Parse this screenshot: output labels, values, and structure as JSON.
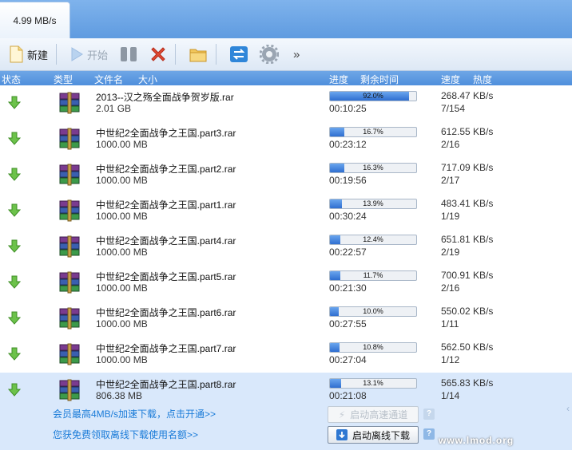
{
  "header": {
    "speed": "4.99 MB/s"
  },
  "toolbar": {
    "new_label": "新建",
    "start_label": "开始",
    "more_label": "»"
  },
  "columns": {
    "status": "状态",
    "type": "类型",
    "filename": "文件名",
    "size": "大小",
    "progress": "进度",
    "remaining": "剩余时间",
    "speed": "速度",
    "heat": "热度"
  },
  "downloads": [
    {
      "name": "2013--汉之殇全面战争贺岁版.rar",
      "size": "2.01 GB",
      "progress_pct": 92.0,
      "progress_label": "92.0%",
      "remaining": "00:10:25",
      "rate": "268.47 KB/s",
      "heat": "7/154"
    },
    {
      "name": "中世纪2全面战争之王国.part3.rar",
      "size": "1000.00 MB",
      "progress_pct": 16.7,
      "progress_label": "16.7%",
      "remaining": "00:23:12",
      "rate": "612.55 KB/s",
      "heat": "2/16"
    },
    {
      "name": "中世纪2全面战争之王国.part2.rar",
      "size": "1000.00 MB",
      "progress_pct": 16.3,
      "progress_label": "16.3%",
      "remaining": "00:19:56",
      "rate": "717.09 KB/s",
      "heat": "2/17"
    },
    {
      "name": "中世纪2全面战争之王国.part1.rar",
      "size": "1000.00 MB",
      "progress_pct": 13.9,
      "progress_label": "13.9%",
      "remaining": "00:30:24",
      "rate": "483.41 KB/s",
      "heat": "1/19"
    },
    {
      "name": "中世纪2全面战争之王国.part4.rar",
      "size": "1000.00 MB",
      "progress_pct": 12.4,
      "progress_label": "12.4%",
      "remaining": "00:22:57",
      "rate": "651.81 KB/s",
      "heat": "2/19"
    },
    {
      "name": "中世纪2全面战争之王国.part5.rar",
      "size": "1000.00 MB",
      "progress_pct": 11.7,
      "progress_label": "11.7%",
      "remaining": "00:21:30",
      "rate": "700.91 KB/s",
      "heat": "2/16"
    },
    {
      "name": "中世纪2全面战争之王国.part6.rar",
      "size": "1000.00 MB",
      "progress_pct": 10.0,
      "progress_label": "10.0%",
      "remaining": "00:27:55",
      "rate": "550.02 KB/s",
      "heat": "1/11"
    },
    {
      "name": "中世纪2全面战争之王国.part7.rar",
      "size": "1000.00 MB",
      "progress_pct": 10.8,
      "progress_label": "10.8%",
      "remaining": "00:27:04",
      "rate": "562.50 KB/s",
      "heat": "1/12"
    },
    {
      "name": "中世纪2全面战争之王国.part8.rar",
      "size": "806.38 MB",
      "progress_pct": 13.1,
      "progress_label": "13.1%",
      "remaining": "00:21:08",
      "rate": "565.83 KB/s",
      "heat": "1/14"
    }
  ],
  "selected_detail": {
    "promo_vip": "会员最高4MB/s加速下载，点击开通>>",
    "promo_offline": "您获免费领取离线下载使用名额>>",
    "accel_button": "启动高速通道",
    "offline_button": "启动离线下载",
    "help_glyph": "?"
  },
  "watermark": "www.lmod.org",
  "colors": {
    "accent": "#4f8fdc",
    "selected_row": "#d9e8fb",
    "link": "#1a7bd8",
    "progress": "#2f6fd0"
  }
}
